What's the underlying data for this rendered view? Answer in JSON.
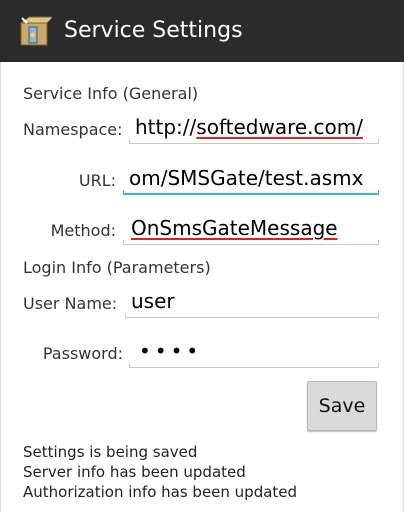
{
  "app": {
    "title": "Service Settings",
    "icon": "package-service-icon"
  },
  "service_info": {
    "header": "Service Info (General)",
    "namespace": {
      "label": "Namespace:",
      "value": "http://softedware.com/"
    },
    "url": {
      "label": "URL:",
      "value": "om/SMSGate/test.asmx"
    },
    "method": {
      "label": "Method:",
      "value": "OnSmsGateMessage"
    }
  },
  "login_info": {
    "header": "Login Info (Parameters)",
    "username": {
      "label": "User Name:",
      "value": "user"
    },
    "password": {
      "label": "Password:",
      "value": "••••"
    }
  },
  "save_label": "Save",
  "status_messages": [
    "Settings is being saved",
    "Server info has been updated",
    "Authorization info has been updated"
  ],
  "colors": {
    "titlebar": "#2b2b2b",
    "focus_underline": "#33b5e5",
    "spellcheck": "#e02020",
    "button": "#dadada"
  }
}
